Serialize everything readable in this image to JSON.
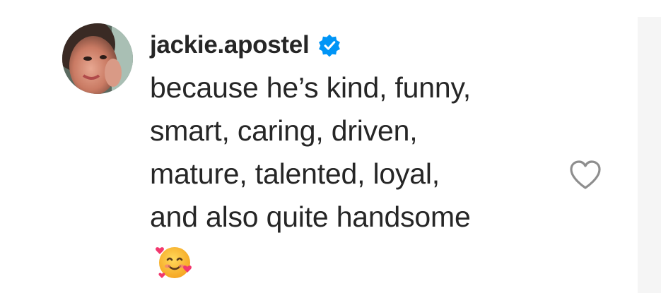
{
  "comment": {
    "username": "jackie.apostel",
    "verified": true,
    "text": "because he’s kind, funny,\nsmart, caring, driven,\nmature, talented, loyal,\nand also quite handsome",
    "emoji_icon": "smiling-face-with-hearts-icon",
    "like_icon": "heart-outline-icon"
  },
  "colors": {
    "text": "#262626",
    "verified_badge": "#0095f6",
    "like_icon": "#8e8e8e",
    "background": "#ffffff"
  }
}
